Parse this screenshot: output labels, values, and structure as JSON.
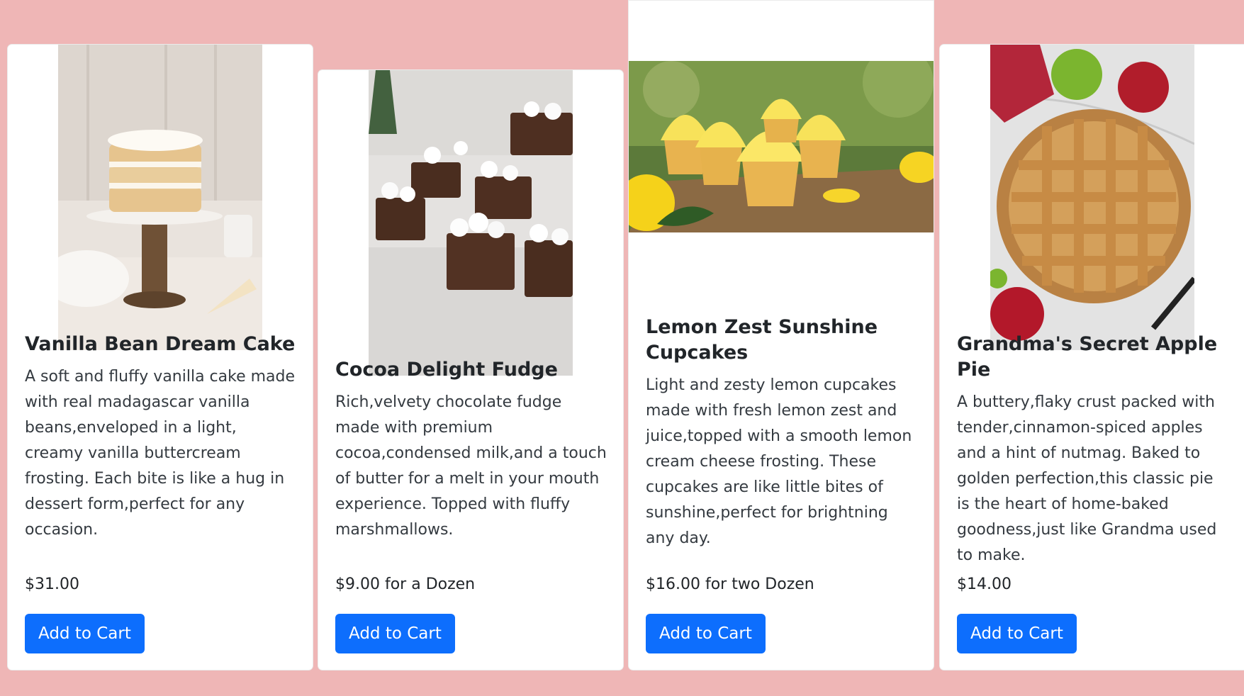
{
  "products": [
    {
      "title": "Vanilla Bean Dream Cake",
      "description": "A soft and fluffy vanilla cake made with real madagascar vanilla beans,enveloped in a light, creamy vanilla buttercream frosting. Each bite is like a hug in dessert form,perfect for any occasion.",
      "price": "$31.00",
      "button": "Add to Cart",
      "image_icon": "layer-cake-photo"
    },
    {
      "title": "Cocoa Delight Fudge",
      "description": "Rich,velvety chocolate fudge made with premium cocoa,condensed milk,and a touch of butter for a melt in your mouth experience. Topped with fluffy marshmallows.",
      "price": "$9.00 for a Dozen",
      "button": "Add to Cart",
      "image_icon": "fudge-photo"
    },
    {
      "title": "Lemon Zest Sunshine Cupcakes",
      "description": "Light and zesty lemon cupcakes made with fresh lemon zest and juice,topped with a smooth lemon cream cheese frosting. These cupcakes are like little bites of sunshine,perfect for brightning any day.",
      "price": "$16.00 for two Dozen",
      "button": "Add to Cart",
      "image_icon": "cupcakes-photo"
    },
    {
      "title": "Grandma's Secret Apple Pie",
      "description": "A buttery,flaky crust packed with tender,cinnamon-spiced apples and a hint of nutmag. Baked to golden perfection,this classic pie is the heart of home-baked goodness,just like Grandma used to make.",
      "price": "$14.00",
      "button": "Add to Cart",
      "image_icon": "apple-pie-photo"
    }
  ],
  "colors": {
    "background": "#efb6b6",
    "button": "#0d6efd",
    "card": "#ffffff"
  }
}
